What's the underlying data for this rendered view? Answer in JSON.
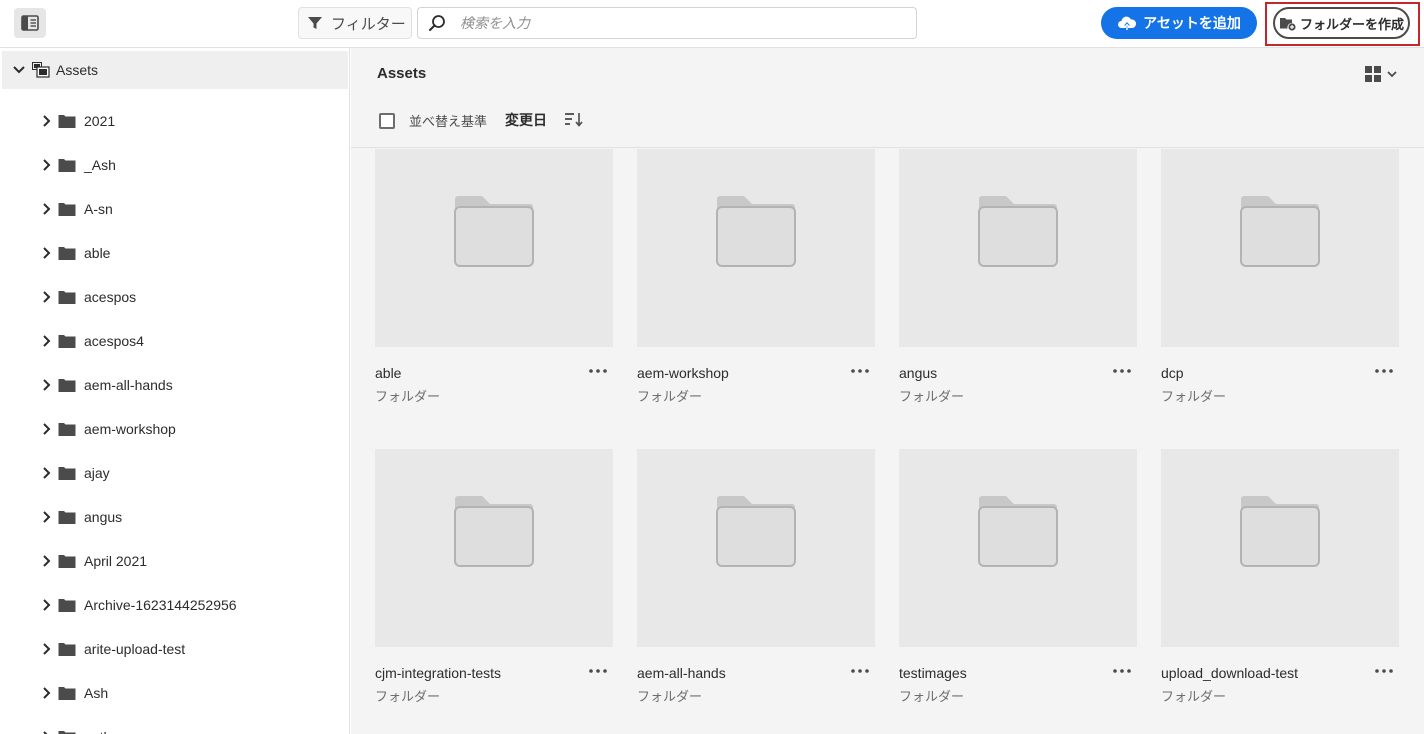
{
  "topbar": {
    "filter_label": "フィルター",
    "search_placeholder": "検索を入力",
    "add_assets_label": "アセットを追加",
    "create_folder_label": "フォルダーを作成"
  },
  "sidebar": {
    "root_label": "Assets",
    "items": [
      {
        "label": "2021"
      },
      {
        "label": "_Ash"
      },
      {
        "label": "A-sn"
      },
      {
        "label": "able"
      },
      {
        "label": "acespos"
      },
      {
        "label": "acespos4"
      },
      {
        "label": "aem-all-hands"
      },
      {
        "label": "aem-workshop"
      },
      {
        "label": "ajay"
      },
      {
        "label": "angus"
      },
      {
        "label": "April 2021"
      },
      {
        "label": "Archive-1623144252956"
      },
      {
        "label": "arite-upload-test"
      },
      {
        "label": "Ash"
      },
      {
        "label": "author"
      }
    ]
  },
  "main": {
    "title": "Assets",
    "sort_by_label": "並べ替え基準",
    "sort_field": "変更日",
    "cards": [
      {
        "name": "able",
        "kind": "フォルダー"
      },
      {
        "name": "aem-workshop",
        "kind": "フォルダー"
      },
      {
        "name": "angus",
        "kind": "フォルダー"
      },
      {
        "name": "dcp",
        "kind": "フォルダー"
      },
      {
        "name": "cjm-integration-tests",
        "kind": "フォルダー"
      },
      {
        "name": "aem-all-hands",
        "kind": "フォルダー"
      },
      {
        "name": "testimages",
        "kind": "フォルダー"
      },
      {
        "name": "upload_download-test",
        "kind": "フォルダー"
      }
    ]
  },
  "colors": {
    "accent": "#1473e6",
    "highlight_border": "#c1272d"
  }
}
